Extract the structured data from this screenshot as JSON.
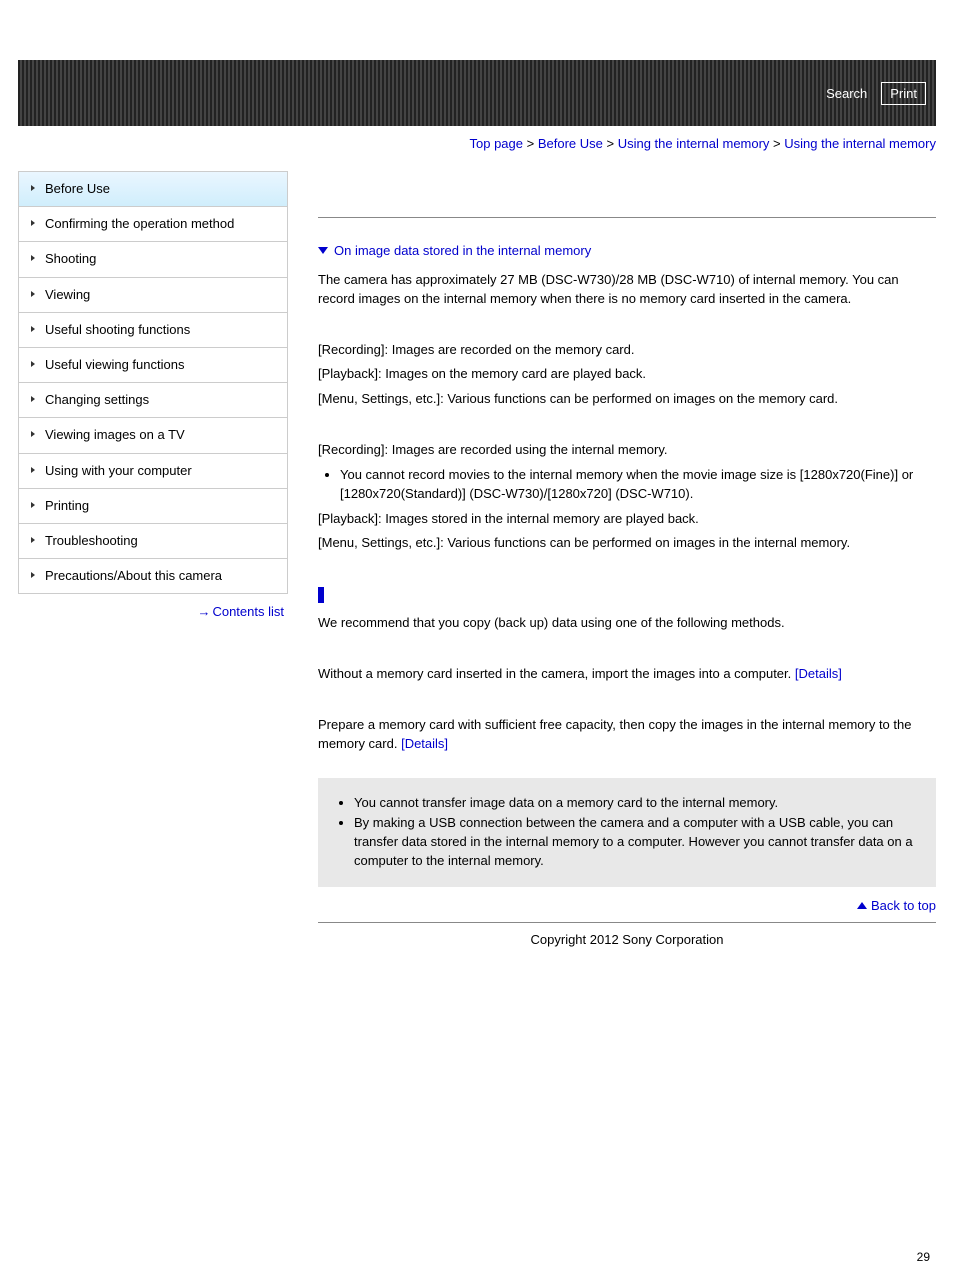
{
  "header": {
    "search_label": "Search",
    "print_label": "Print"
  },
  "breadcrumb": {
    "items": [
      "Top page",
      "Before Use",
      "Using the internal memory",
      "Using the internal memory"
    ],
    "sep": " > "
  },
  "sidebar": {
    "items": [
      {
        "label": "Before Use",
        "active": true
      },
      {
        "label": "Confirming the operation method"
      },
      {
        "label": "Shooting"
      },
      {
        "label": "Viewing"
      },
      {
        "label": "Useful shooting functions"
      },
      {
        "label": "Useful viewing functions"
      },
      {
        "label": "Changing settings"
      },
      {
        "label": "Viewing images on a TV"
      },
      {
        "label": "Using with your computer"
      },
      {
        "label": "Printing"
      },
      {
        "label": "Troubleshooting"
      },
      {
        "label": "Precautions/About this camera"
      }
    ],
    "contents_list_label": "Contents list"
  },
  "main": {
    "section_link": "On image data stored in the internal memory",
    "intro": "The camera has approximately 27 MB (DSC-W730)/28 MB (DSC-W710) of internal memory. You can record images on the internal memory when there is no memory card inserted in the camera.",
    "block1": {
      "recording": "[Recording]: Images are recorded on the memory card.",
      "playback": "[Playback]: Images on the memory card are played back.",
      "menu": "[Menu, Settings, etc.]: Various functions can be performed on images on the memory card."
    },
    "block2": {
      "recording": "[Recording]: Images are recorded using the internal memory.",
      "bullet": "You cannot record movies to the internal memory when the movie image size is [1280x720(Fine)] or [1280x720(Standard)] (DSC-W730)/[1280x720] (DSC-W710).",
      "playback": "[Playback]: Images stored in the internal memory are played back.",
      "menu": "[Menu, Settings, etc.]: Various functions can be performed on images in the internal memory."
    },
    "recommend": "We recommend that you copy (back up) data using one of the following methods.",
    "method1": {
      "text": "Without a memory card inserted in the camera, import the images into a computer. ",
      "details": "[Details]"
    },
    "method2": {
      "text": "Prepare a memory card with sufficient free capacity, then copy the images in the internal memory to the memory card. ",
      "details": "[Details]"
    },
    "notes": {
      "n1": "You cannot transfer image data on a memory card to the internal memory.",
      "n2": "By making a USB connection between the camera and a computer with a USB cable, you can transfer data stored in the internal memory to a computer. However you cannot transfer data on a computer to the internal memory."
    },
    "back_to_top": "Back to top"
  },
  "footer": {
    "copyright": "Copyright 2012 Sony Corporation"
  },
  "page_number": "29"
}
